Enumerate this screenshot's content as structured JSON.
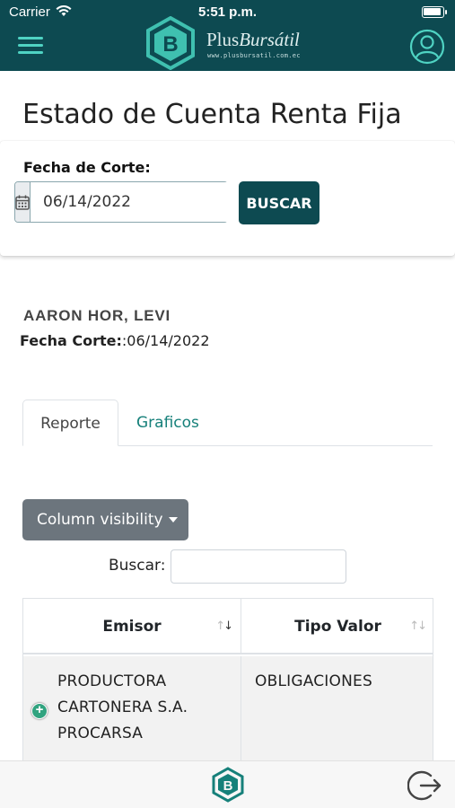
{
  "status_bar": {
    "carrier": "Carrier",
    "time": "5:51 p.m."
  },
  "header": {
    "brand_plain": "Plus",
    "brand_italic": "Bursátil",
    "brand_url": "www.plusbursatil.com.ec"
  },
  "page": {
    "title": "Estado de Cuenta Renta Fija"
  },
  "filter": {
    "label": "Fecha de Corte:",
    "date_value": "06/14/2022",
    "search_button": "BUSCAR"
  },
  "client": {
    "name": "AARON HOR, LEVI",
    "fecha_label": "Fecha Corte:",
    "fecha_value": ":06/14/2022"
  },
  "tabs": [
    {
      "label": "Reporte",
      "active": true
    },
    {
      "label": "Graficos",
      "active": false
    }
  ],
  "table_controls": {
    "column_visibility": "Column visibility",
    "search_label": "Buscar:",
    "search_value": ""
  },
  "table": {
    "columns": [
      "Emisor",
      "Tipo Valor"
    ],
    "rows": [
      {
        "emisor_lines": [
          "PRODUCTORA",
          "CARTONERA S.A.",
          "PROCARSA"
        ],
        "tipo_valor": "OBLIGACIONES"
      }
    ]
  },
  "icons": {
    "menu": "hamburger-menu-icon",
    "user": "user-circle-icon",
    "calendar": "calendar-icon",
    "expand": "plus-circle-icon",
    "logout": "logout-icon",
    "home": "brand-logo-icon"
  },
  "colors": {
    "primary": "#0d4a51",
    "accent": "#4fd3c3",
    "link": "#16807a",
    "secondary_button": "#6c757d"
  }
}
